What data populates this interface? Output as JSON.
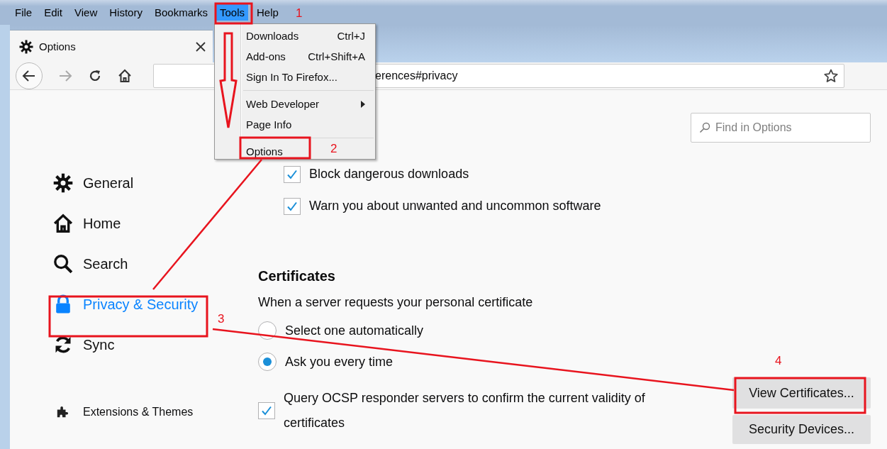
{
  "menubar": [
    {
      "label": "File",
      "selected": false
    },
    {
      "label": "Edit",
      "selected": false
    },
    {
      "label": "View",
      "selected": false
    },
    {
      "label": "History",
      "selected": false
    },
    {
      "label": "Bookmarks",
      "selected": false
    },
    {
      "label": "Tools",
      "selected": true
    },
    {
      "label": "Help",
      "selected": false
    }
  ],
  "tab": {
    "title": "Options"
  },
  "address_bar": {
    "url": "erences#privacy"
  },
  "tools_menu": [
    {
      "kind": "item",
      "label": "Downloads",
      "shortcut": "Ctrl+J"
    },
    {
      "kind": "item",
      "label": "Add-ons",
      "shortcut": "Ctrl+Shift+A"
    },
    {
      "kind": "item",
      "label": "Sign In To Firefox..."
    },
    {
      "kind": "separator"
    },
    {
      "kind": "item",
      "label": "Web Developer",
      "submenu": true
    },
    {
      "kind": "item",
      "label": "Page Info"
    },
    {
      "kind": "separator"
    },
    {
      "kind": "item",
      "label": "Options"
    }
  ],
  "search": {
    "placeholder": "Find in Options"
  },
  "sidebar": {
    "items": [
      {
        "label": "General",
        "selected": false
      },
      {
        "label": "Home",
        "selected": false
      },
      {
        "label": "Search",
        "selected": false
      },
      {
        "label": "Privacy & Security",
        "selected": true
      },
      {
        "label": "Sync",
        "selected": false
      }
    ],
    "footer": "Extensions & Themes"
  },
  "downloads": [
    {
      "label": "Block dangerous downloads",
      "checked": true
    },
    {
      "label": "Warn you about unwanted and uncommon software",
      "checked": true
    }
  ],
  "certificates": {
    "heading": "Certificates",
    "description": "When a server requests your personal certificate",
    "choices": [
      {
        "label": "Select one automatically",
        "selected": false
      },
      {
        "label": "Ask you every time",
        "selected": true
      }
    ],
    "ocsp": {
      "label": "Query OCSP responder servers to confirm the current validity of certificates",
      "checked": true
    },
    "buttons": [
      "View Certificates...",
      "Security Devices..."
    ]
  },
  "annotations": [
    "1",
    "2",
    "3",
    "4"
  ]
}
